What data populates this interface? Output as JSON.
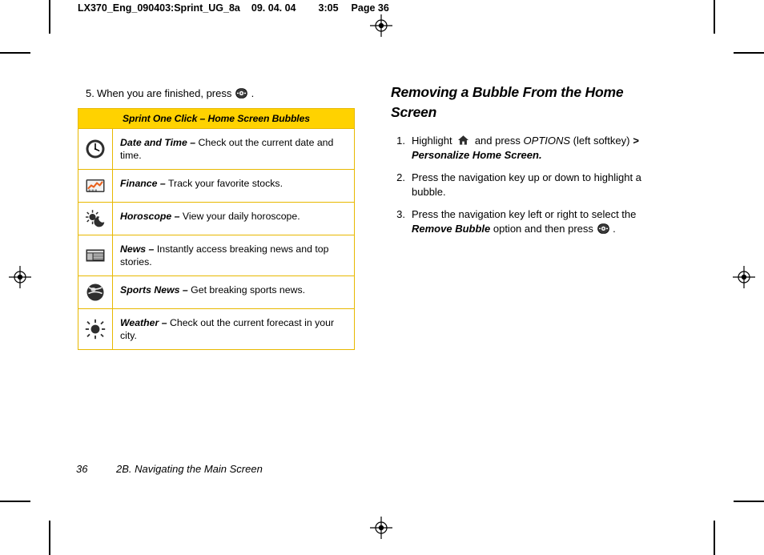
{
  "page": {
    "header_slug": {
      "filename": "LX370_Eng_090403:Sprint_UG_8a",
      "date": "09. 04. 04",
      "time": "3:05",
      "page_label": "Page 36"
    },
    "footer": {
      "page_number": "36",
      "chapter": "2B. Navigating the Main Screen"
    }
  },
  "left_column": {
    "step": {
      "number": "5.",
      "text_before": "When you are finished, press",
      "key_icon": "ok-key-icon",
      "text_after": "."
    },
    "table": {
      "caption": "Sprint One Click – Home Screen Bubbles",
      "rows": [
        {
          "icon": "clock-icon",
          "term": "Date and Time –",
          "description": "Check out the current date and time."
        },
        {
          "icon": "finance-chart-icon",
          "term": "Finance –",
          "description": "Track your favorite stocks."
        },
        {
          "icon": "sun-moon-icon",
          "term": "Horoscope –",
          "description": "View your daily horoscope."
        },
        {
          "icon": "newspaper-icon",
          "term": "News –",
          "description": "Instantly access breaking news and top stories."
        },
        {
          "icon": "sports-ball-icon",
          "term": "Sports News –",
          "description": "Get breaking sports news."
        },
        {
          "icon": "sun-icon",
          "term": "Weather –",
          "description": "Check out the current forecast in your city."
        }
      ]
    }
  },
  "right_column": {
    "heading": "Removing a Bubble From the Home Screen",
    "steps": [
      {
        "number": "1.",
        "parts": [
          {
            "type": "text",
            "value": "Highlight "
          },
          {
            "type": "icon",
            "value": "home-icon"
          },
          {
            "type": "text",
            "value": " and press "
          },
          {
            "type": "italic",
            "value": "OPTIONS"
          },
          {
            "type": "text",
            "value": " (left softkey) "
          },
          {
            "type": "bold-italic",
            "value": ">"
          },
          {
            "type": "bold-italic",
            "value": "Personalize Home Screen."
          }
        ]
      },
      {
        "number": "2.",
        "parts": [
          {
            "type": "text",
            "value": "Press the navigation key up or down to highlight a bubble."
          }
        ]
      },
      {
        "number": "3.",
        "parts": [
          {
            "type": "text",
            "value": "Press the navigation key left or right to select the "
          },
          {
            "type": "bold-italic",
            "value": "Remove Bubble"
          },
          {
            "type": "text",
            "value": " option and then press "
          },
          {
            "type": "icon",
            "value": "ok-key-icon"
          },
          {
            "type": "text",
            "value": " ."
          }
        ]
      }
    ]
  },
  "colors": {
    "table_header_bg": "#ffd200",
    "table_border": "#e8b800",
    "text": "#000000",
    "page_bg": "#ffffff"
  }
}
